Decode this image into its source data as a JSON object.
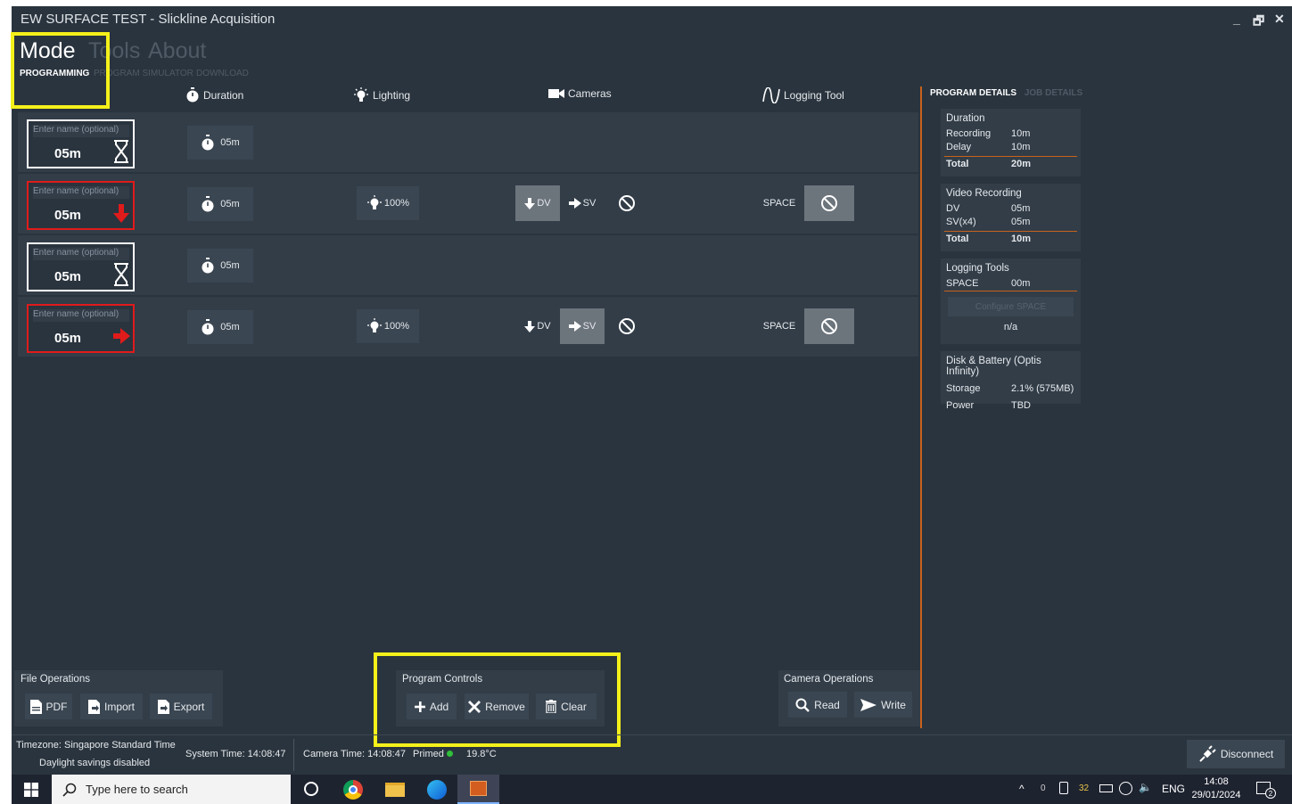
{
  "window": {
    "title": "EW SURFACE TEST - Slickline Acquisition",
    "minimize": "_",
    "restore": "🗗",
    "close": "✕"
  },
  "menu": {
    "items": [
      {
        "label": "Mode",
        "active": true
      },
      {
        "label": "Tools",
        "active": false
      },
      {
        "label": "About",
        "active": false
      }
    ],
    "subitems": [
      {
        "label": "PROGRAMMING",
        "active": true
      },
      {
        "label": "PROGRAM SIMULATOR",
        "active": false
      },
      {
        "label": "DOWNLOAD",
        "active": false
      }
    ]
  },
  "columns": {
    "duration": "Duration",
    "lighting": "Lighting",
    "cameras": "Cameras",
    "logging": "Logging Tool"
  },
  "rows": [
    {
      "placeholder": "Enter name (optional)",
      "name_value": "05m",
      "type_icon": "hourglass-icon",
      "border": "white",
      "duration": "05m"
    },
    {
      "placeholder": "Enter name (optional)",
      "name_value": "05m",
      "type_icon": "arrow-down-icon",
      "border": "red",
      "duration": "05m",
      "lighting": "100%",
      "cam_dv": "DV",
      "cam_sv": "SV",
      "cam_selected": "DV",
      "log_label": "SPACE"
    },
    {
      "placeholder": "Enter name (optional)",
      "name_value": "05m",
      "type_icon": "hourglass-icon",
      "border": "white",
      "duration": "05m"
    },
    {
      "placeholder": "Enter name (optional)",
      "name_value": "05m",
      "type_icon": "arrow-right-icon",
      "border": "red",
      "duration": "05m",
      "lighting": "100%",
      "cam_dv": "DV",
      "cam_sv": "SV",
      "cam_selected": "SV",
      "log_label": "SPACE"
    }
  ],
  "details": {
    "tab_active": "PROGRAM DETAILS",
    "tab_inactive": "JOB DETAILS",
    "duration": {
      "title": "Duration",
      "recording_label": "Recording",
      "recording": "10m",
      "delay_label": "Delay",
      "delay": "10m",
      "total_label": "Total",
      "total": "20m"
    },
    "video": {
      "title": "Video Recording",
      "dv_label": "DV",
      "dv": "05m",
      "sv_label": "SV(x4)",
      "sv": "05m",
      "total_label": "Total",
      "total": "10m"
    },
    "logging": {
      "title": "Logging Tools",
      "space_label": "SPACE",
      "space": "00m",
      "configure": "Configure SPACE",
      "na": "n/a"
    },
    "disk": {
      "title": "Disk & Battery (Optis Infinity)",
      "storage_label": "Storage",
      "storage": "2.1% (575MB)",
      "power_label": "Power",
      "power": "TBD"
    }
  },
  "file_ops": {
    "title": "File Operations",
    "pdf": "PDF",
    "import": "Import",
    "export": "Export"
  },
  "program_controls": {
    "title": "Program Controls",
    "add": "Add",
    "remove": "Remove",
    "clear": "Clear"
  },
  "camera_ops": {
    "title": "Camera Operations",
    "read": "Read",
    "write": "Write"
  },
  "status": {
    "timezone": "Timezone: Singapore Standard Time",
    "dst": "Daylight savings disabled",
    "system_time": "System Time: 14:08:47",
    "camera_time": "Camera Time: 14:08:47",
    "primed": "Primed",
    "temperature": "19.8°C",
    "disconnect": "Disconnect"
  },
  "taskbar": {
    "search_placeholder": "Type here to search",
    "tray_count_a": "0",
    "tray_count_b": "32",
    "lang": "ENG",
    "time": "14:08",
    "date": "29/01/2024",
    "notif": "2"
  },
  "colors": {
    "accent": "#c8621c",
    "highlight": "#f4f01a",
    "alert_red": "#e01b1b",
    "bg": "#2a343e"
  }
}
